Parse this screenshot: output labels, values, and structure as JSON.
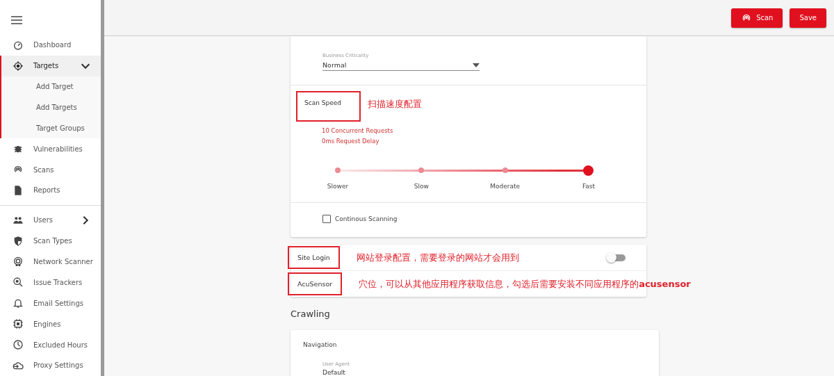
{
  "toolbar": {
    "buttons": [
      {
        "label": "Scan",
        "kind": "scan"
      },
      {
        "label": "Save",
        "kind": "plain"
      }
    ]
  },
  "sidebar": {
    "groups": [
      [
        {
          "label": "Dashboard",
          "selected": false
        },
        {
          "label": "Targets",
          "selected": true,
          "expanded": true,
          "children": [
            {
              "label": "Add Target"
            },
            {
              "label": "Add Targets"
            },
            {
              "label": "Target Groups"
            }
          ]
        },
        {
          "label": "Vulnerabilities",
          "selected": false
        },
        {
          "label": "Scans",
          "selected": false
        },
        {
          "label": "Reports",
          "selected": false
        }
      ],
      [
        {
          "label": "Users",
          "selected": false,
          "expanded": false
        },
        {
          "label": "Scan Types",
          "selected": false
        },
        {
          "label": "Network Scanner",
          "selected": false
        },
        {
          "label": "Issue Trackers",
          "selected": false
        },
        {
          "label": "Email Settings",
          "selected": false
        },
        {
          "label": "Engines",
          "selected": false
        },
        {
          "label": "Excluded Hours",
          "selected": false
        },
        {
          "label": "Proxy Settings",
          "selected": false
        }
      ]
    ]
  },
  "business_criticality": {
    "label": "Business Criticality",
    "value": "Normal"
  },
  "scan_speed": {
    "title": "Scan Speed",
    "annotated": true,
    "note": "扫描速度配置",
    "details": [
      "10 Concurrent Requests",
      "0ms Request Delay"
    ],
    "stops": [
      "Slower",
      "Slow",
      "Moderate",
      "Fast"
    ],
    "level": 1
  },
  "continuous_scanning": {
    "label": "Continous Scanning",
    "checked": false
  },
  "options": [
    {
      "label": "Site Login",
      "annotated": true,
      "note": "网站登录配置，需要登录的网站才会用到",
      "kind": "switch",
      "on": false
    },
    {
      "label": "AcuSensor",
      "annotated": true,
      "note": "穴位，可以从其他应用程序获取信息，勾选后需要安装不同应用程序的**acusensor**",
      "kind": "plain"
    }
  ],
  "crawling": {
    "heading": "Crawling",
    "section": "Navigation",
    "field_label": "User Agent",
    "field_value": "Default"
  }
}
